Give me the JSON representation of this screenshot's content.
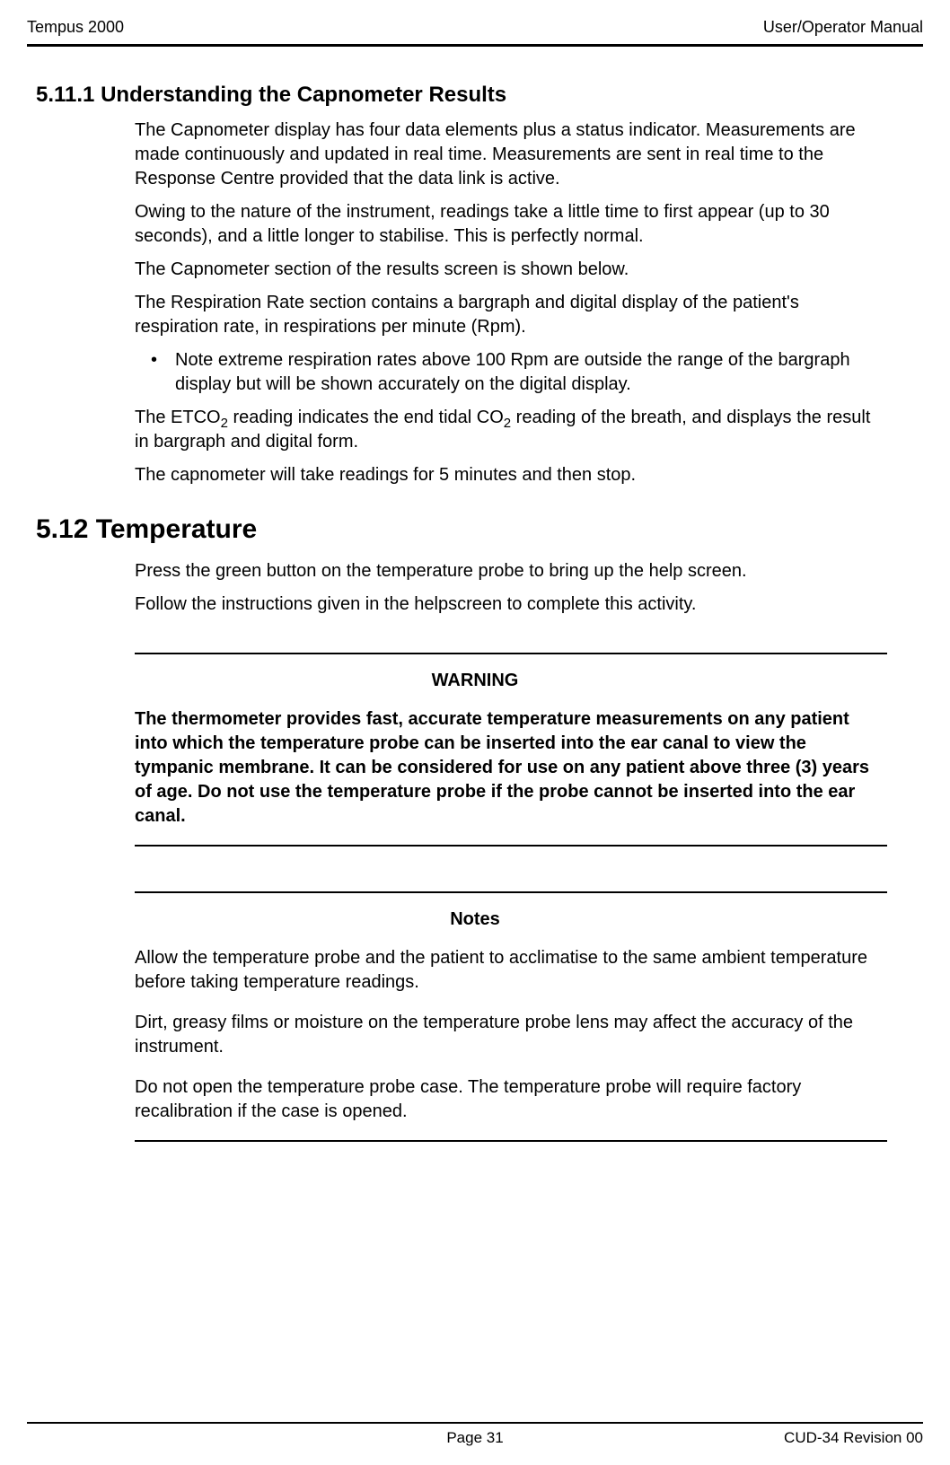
{
  "header": {
    "left": "Tempus 2000",
    "right": "User/Operator Manual"
  },
  "s1": {
    "heading": "5.11.1 Understanding the Capnometer Results",
    "p1": "The Capnometer display has four data elements plus a status indicator. Measurements are made continuously and updated in real time.  Measurements are sent in real time to the Response Centre provided that the data link is active.",
    "p2": "Owing to the nature of the instrument, readings take a little time to first appear (up to 30 seconds), and a little longer to stabilise.  This is perfectly normal.",
    "p3": "The Capnometer section of the results screen is shown below.",
    "p4": "The Respiration Rate section contains a bargraph and digital display of the patient's respiration rate, in respirations per minute (Rpm).",
    "bullet1": "Note extreme respiration rates above 100 Rpm are outside the range of the bargraph display but will be shown accurately on the digital display.",
    "p5a": "The ETCO",
    "p5b": " reading indicates the end tidal CO",
    "p5c": " reading of the breath, and displays the result in bargraph and digital form.",
    "p6": "The capnometer will take readings for 5 minutes and then stop."
  },
  "s2": {
    "heading": "5.12  Temperature",
    "p1": "Press the green button on the temperature probe to bring up the help screen.",
    "p2": "Follow the instructions given in the helpscreen to complete this activity."
  },
  "warning": {
    "heading": "WARNING",
    "text": "The thermometer provides fast, accurate temperature measurements on any patient into which the temperature probe can be inserted into the ear canal to view the tympanic membrane.  It can be considered for use on any patient above three (3) years of age.  Do not use the temperature probe if the probe cannot be inserted into the ear canal."
  },
  "notes": {
    "heading": "Notes",
    "p1": "Allow the temperature probe and the patient to acclimatise to the same ambient temperature before taking temperature readings.",
    "p2": "Dirt, greasy films or moisture on the temperature probe lens may affect the accuracy of the instrument.",
    "p3": "Do not open the temperature probe case.  The temperature probe will require factory recalibration if the case is opened."
  },
  "footer": {
    "page_label": "Page   31",
    "revision": "CUD-34 Revision 00"
  },
  "sub2": "2"
}
